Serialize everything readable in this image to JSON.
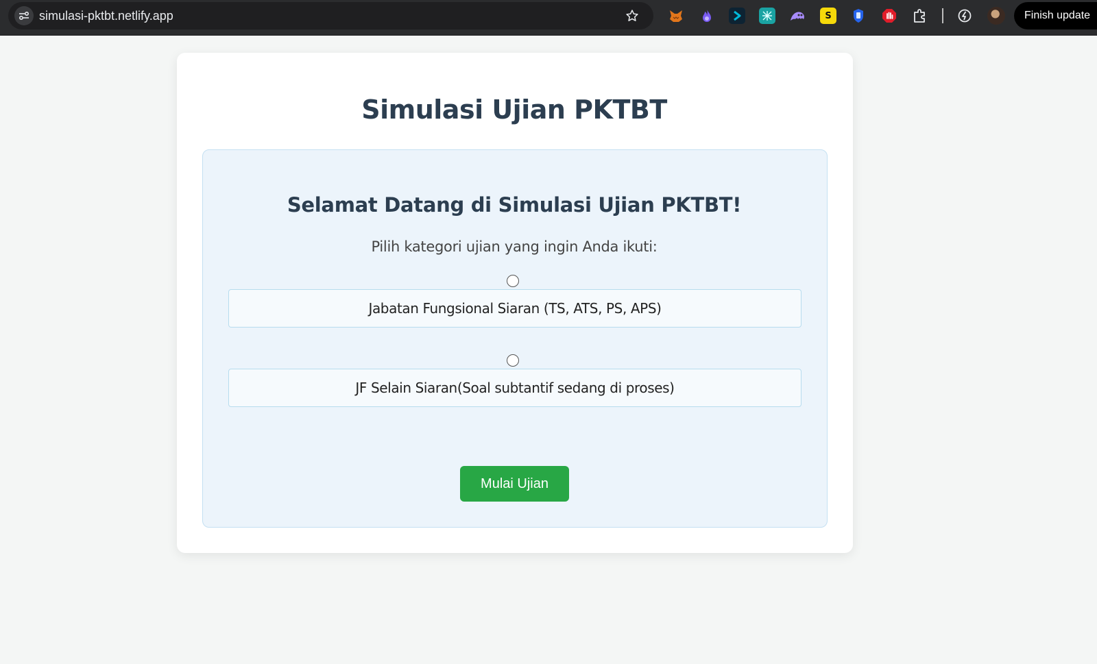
{
  "browser": {
    "url": "simulasi-pktbt.netlify.app",
    "finish_button": "Finish update",
    "extensions": [
      {
        "icon": "fox-extension-icon",
        "color": "#e2761b"
      },
      {
        "icon": "flame-extension-icon",
        "color": "#7b5cf5"
      },
      {
        "icon": "arrow-extension-icon",
        "color": "#00b8d9"
      },
      {
        "icon": "grid-extension-icon",
        "color": "#1aa3a3"
      },
      {
        "icon": "ghost-extension-icon",
        "color": "#a78bfa"
      },
      {
        "icon": "s-extension-icon",
        "color": "#f5d90a"
      },
      {
        "icon": "shield-extension-icon",
        "color": "#3b82f6"
      },
      {
        "icon": "stop-hand-extension-icon",
        "color": "#e11d2a"
      },
      {
        "icon": "puzzle-extensions-icon",
        "color": "#e8eaed"
      },
      {
        "icon": "performance-icon",
        "color": "#e8eaed"
      }
    ]
  },
  "page": {
    "title": "Simulasi Ujian PKTBT",
    "welcome": "Selamat Datang di Simulasi Ujian PKTBT!",
    "instruction": "Pilih kategori ujian yang ingin Anda ikuti:",
    "options": [
      {
        "label": "Jabatan Fungsional Siaran (TS, ATS, PS, APS)",
        "selected": false
      },
      {
        "label": "JF Selain Siaran(Soal subtantif sedang di proses)",
        "selected": false
      }
    ],
    "start_button": "Mulai Ujian"
  },
  "colors": {
    "title": "#2c3e50",
    "panel_bg": "#ecf4fb",
    "panel_border": "#c4e0f2",
    "button": "#28a745"
  }
}
